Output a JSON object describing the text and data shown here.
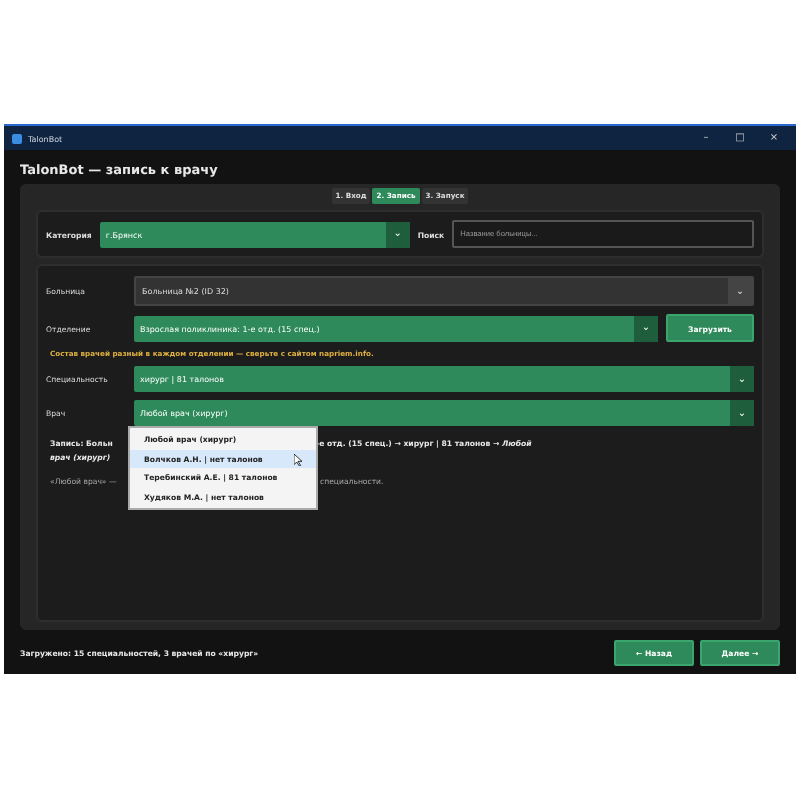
{
  "window": {
    "title": "TalonBot",
    "controls": [
      "–",
      "□",
      "×"
    ]
  },
  "chevron": "⌄",
  "header": {
    "title": "TalonBot — запись к врачу"
  },
  "tabs": [
    {
      "label": "1. Вход",
      "selected": false
    },
    {
      "label": "2. Запись",
      "selected": true
    },
    {
      "label": "3. Запуск",
      "selected": false
    }
  ],
  "category": {
    "label": "Категория",
    "value": "г.Брянск"
  },
  "search": {
    "label": "Поиск",
    "placeholder": "Название больницы..."
  },
  "hospital": {
    "label": "Больница",
    "value": "Больница №2 (ID 32)"
  },
  "department": {
    "label": "Отделение",
    "value": "Взрослая поликлиника: 1-е отд. (15 спец.)",
    "button": "Загрузить"
  },
  "warning": "Состав врачей разный в каждом отделении — сверьте с сайтом napriem.info.",
  "specialty": {
    "label": "Специальность",
    "value": "хирург | 81 талонов"
  },
  "doctor": {
    "label": "Врач",
    "value": "Любой врач (хирург)"
  },
  "doctor_options": [
    {
      "label": "Любой врач (хирург)",
      "selected": false
    },
    {
      "label": "Волчков А.Н. | нет талонов",
      "selected": true
    },
    {
      "label": "Теребинский А.Е. | 81 талонов",
      "selected": false
    },
    {
      "label": "Худяков М.А. | нет талонов",
      "selected": false
    }
  ],
  "summary": {
    "start": "Запись: Больн",
    "end": "-е отд. (15 спец.) → хирург | 81 талонов → *Любой*",
    "line2": "*врач (хирург)*"
  },
  "note": {
    "start": "«Любой врач» —",
    "end": "специальности."
  },
  "status_bar": "Загружено: 15 специальностей, 3 врачей по «хирург»",
  "buttons": {
    "back": "← Назад",
    "next": "Далее →"
  }
}
